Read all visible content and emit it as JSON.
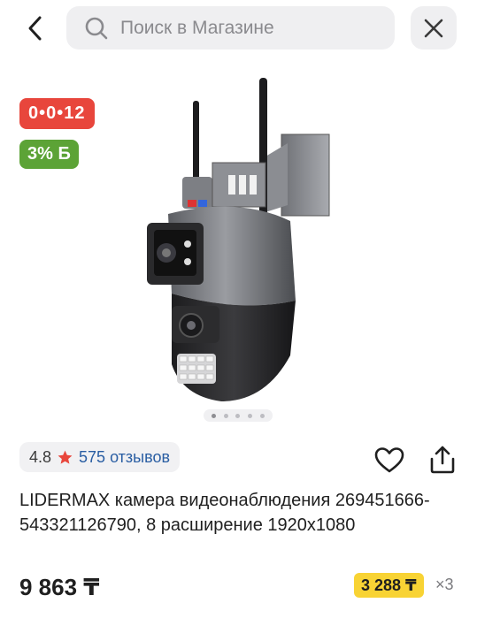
{
  "header": {
    "search_placeholder": "Поиск в Магазине",
    "icons": {
      "back": "chevron-left-icon",
      "search": "search-icon",
      "close": "close-icon"
    }
  },
  "badges": {
    "timer": "0•0•12",
    "bonus": "3% Б",
    "timer_color": "#e8463c",
    "bonus_color": "#5ca336"
  },
  "gallery": {
    "image": "dual-lens-ptz-security-camera",
    "dots_total": 5,
    "active_dot": 1
  },
  "rating": {
    "value": "4.8",
    "reviews": "575 отзывов",
    "star_color": "#e8463c"
  },
  "actions": {
    "favorite_icon": "heart-icon",
    "share_icon": "share-icon"
  },
  "product": {
    "title": "LIDERMAX камера видеонаблюдения 269451666-543321126790, 8 расширение 1920x1080",
    "price": "9 863 ₸",
    "installment_price": "3 288 ₸",
    "installment_multiplier": "×3",
    "installment_color": "#f8d334"
  }
}
